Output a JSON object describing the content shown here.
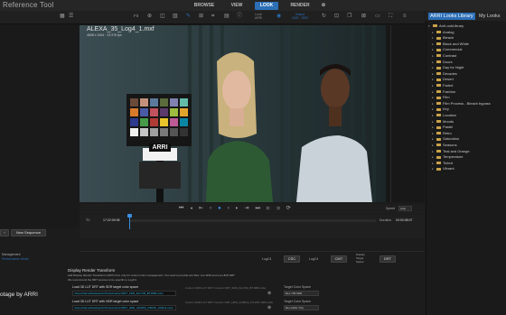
{
  "app": {
    "title": "Reference Tool"
  },
  "nav": {
    "tabs": [
      "BROWSE",
      "VIEW",
      "LOOK",
      "RENDER"
    ],
    "active": "LOOK"
  },
  "toolbar": {
    "zoom": "Fit",
    "look_label": "Look",
    "look_sub": "ARRI",
    "cdl_label": "CDL",
    "output_label": "Output",
    "output_sub": "HDR · SDR"
  },
  "library": {
    "tabs": [
      "ARRI Looks Library",
      "My Looks"
    ],
    "active_tab": "ARRI Looks Library",
    "items": [
      {
        "label": "ArriLookLibrary",
        "level": 0,
        "arrow": "▾"
      },
      {
        "label": "Analog",
        "level": 1,
        "arrow": "▸"
      },
      {
        "label": "Bleach",
        "level": 1,
        "arrow": "▸"
      },
      {
        "label": "Black and White",
        "level": 1,
        "arrow": "▸"
      },
      {
        "label": "Commercial",
        "level": 1,
        "arrow": "▸"
      },
      {
        "label": "Contrast",
        "level": 1,
        "arrow": "▸"
      },
      {
        "label": "Doors",
        "level": 1,
        "arrow": "▸"
      },
      {
        "label": "Day for Night",
        "level": 1,
        "arrow": "▸"
      },
      {
        "label": "Decades",
        "level": 1,
        "arrow": "▸"
      },
      {
        "label": "Desert",
        "level": 1,
        "arrow": "▸"
      },
      {
        "label": "Faded",
        "level": 1,
        "arrow": "▸"
      },
      {
        "label": "Fashion",
        "level": 1,
        "arrow": "▸"
      },
      {
        "label": "Film",
        "level": 1,
        "arrow": "▸"
      },
      {
        "label": "Film Process - Bleach bypass",
        "level": 1,
        "arrow": "▸"
      },
      {
        "label": "Key",
        "level": 1,
        "arrow": "▸"
      },
      {
        "label": "Location",
        "level": 1,
        "arrow": "▸"
      },
      {
        "label": "Moods",
        "level": 1,
        "arrow": "▸"
      },
      {
        "label": "Pastel",
        "level": 1,
        "arrow": "▸"
      },
      {
        "label": "Retro",
        "level": 1,
        "arrow": "▸"
      },
      {
        "label": "Saturation",
        "level": 1,
        "arrow": "▸"
      },
      {
        "label": "Seasons",
        "level": 1,
        "arrow": "▸"
      },
      {
        "label": "Teal and Orange",
        "level": 1,
        "arrow": "▸"
      },
      {
        "label": "Temperature",
        "level": 1,
        "arrow": "▸"
      },
      {
        "label": "Tinted",
        "level": 1,
        "arrow": "▸"
      },
      {
        "label": "Vibrant",
        "level": 1,
        "arrow": "▸"
      }
    ]
  },
  "viewer": {
    "clip_name": "ALEXA_35_Log4_1.mxf",
    "clip_res": "4608 x 3164 · 23.976 fps",
    "chart_logo": "ARRI"
  },
  "transport": {
    "speed_label": "Speed",
    "speed_value": "Auto"
  },
  "timeline": {
    "tc_label": "TC",
    "tc_value": "17:22:09:08",
    "duration_label": "Duration",
    "duration_value": "00:00:08:07"
  },
  "left": {
    "new_sequence": "New Sequence",
    "management_label": "Management",
    "management_sub": "Performance Mode"
  },
  "colorspace": {
    "a_label": "LogC4",
    "a_btn": "CSC",
    "b_label": "LogC4",
    "c_label": "CMT",
    "d_label": "Display Target Space",
    "d_btn": "DRT"
  },
  "drt": {
    "title": "Display Render Transform",
    "desc1": "Add Display Render Transforms (DRT) from only for custom color management. You need to provide two files: one SDR and one HDR DRT.",
    "desc2": "We recommend the DRT sources to be specific to LogC4.",
    "sdr_label": "Load 3D LUT DRT with SDR target color space",
    "sdr_path": "/Users/Name/Desktop/ArriToolsCustom/DRT_SDR_Rec709_BT1886.cube",
    "sdr_path2": "Custom SDR-LUT DRT: Custom DRT_SDR_Rec709_BT1886.cube",
    "sdr_target_label": "Target Color Space",
    "sdr_target": "Rec 709 SDR",
    "hdr_label": "Load 3D LUT DRT with HDR target color space",
    "hdr_path": "/Users/Name/Desktop/ArriToolsCustom/DRT_HDR_2100PQ_P3D65_1000nit.cube",
    "hdr_path2": "Custom HDR LUT DRT: Custom DRT_HDR_2100PQ_P3-D65 1000.cube",
    "hdr_target_label": "Target Color Space",
    "hdr_target": "Rec 2100 / PQ"
  },
  "footer": {
    "brand": "otage by ARRI"
  },
  "colors": {
    "accent": "#2c6fb7",
    "folder": "#caa24a",
    "path": "#2fb4e0",
    "playhead": "#3a8fe0"
  }
}
